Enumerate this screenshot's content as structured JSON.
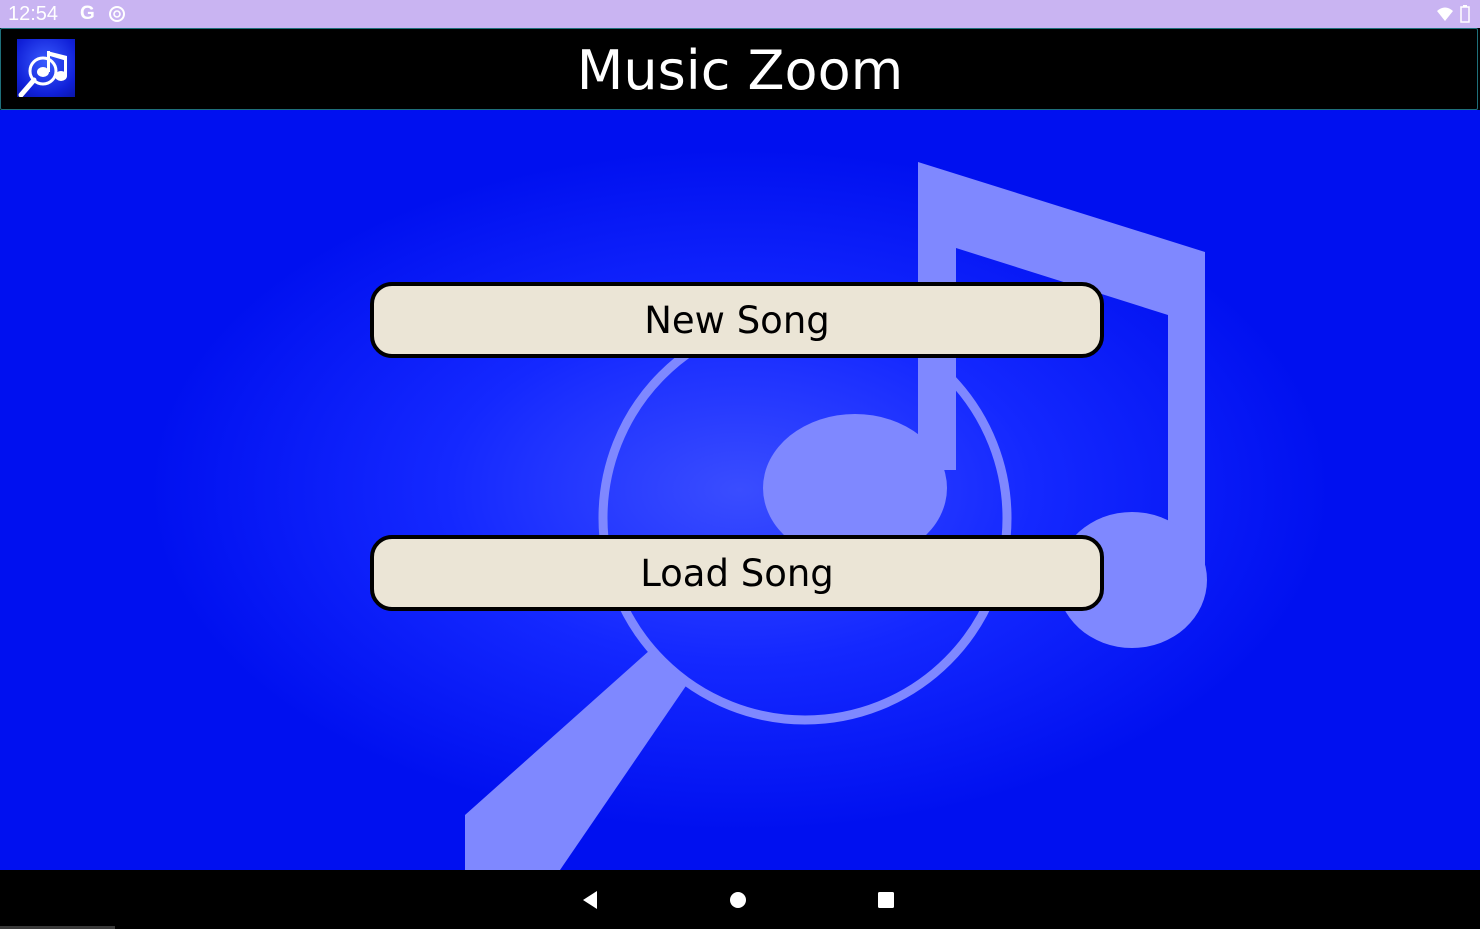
{
  "status_bar": {
    "time": "12:54",
    "g_label": "G",
    "icons": [
      "google-icon",
      "sync-icon",
      "wifi-icon",
      "battery-icon"
    ]
  },
  "app": {
    "title": "Music Zoom",
    "logo_icon": "music-zoom-logo-icon"
  },
  "menu": {
    "new_song_label": "New Song",
    "load_song_label": "Load Song"
  },
  "nav_bar": {
    "icons": [
      "back-icon",
      "home-icon",
      "recents-icon"
    ]
  },
  "colors": {
    "status_bar_bg": "#c9b4f2",
    "title_bar_bg": "#000000",
    "main_bg": "#0010f0",
    "button_bg": "#ebe5d6",
    "watermark": "#8088ff"
  }
}
